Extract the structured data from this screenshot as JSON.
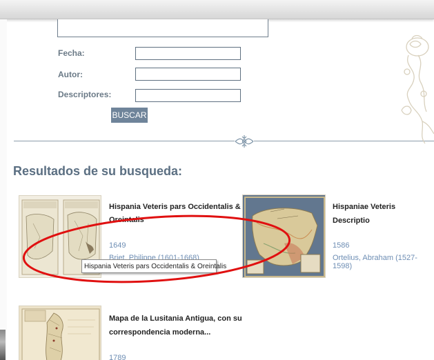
{
  "search_form": {
    "fields": [
      {
        "label": "Fecha:",
        "value": ""
      },
      {
        "label": "Autor:",
        "value": ""
      },
      {
        "label": "Descriptores:",
        "value": ""
      }
    ],
    "search_button_label": "BUSCAR"
  },
  "results": {
    "heading": "Resultados de su busqueda:",
    "items": [
      {
        "title_line1": "Hispania Veteris pars Occidentalis &",
        "title_line2": "Oreintalis",
        "year": "1649",
        "author": "Briet, Philippe (1601-1668)"
      },
      {
        "title_line1": "Hispaniae Veteris Descriptio",
        "title_line2": "",
        "year": "1586",
        "author": "Ortelius, Abraham (1527-1598)"
      },
      {
        "title_line1": "Mapa de la Lusitania Antigua, con su",
        "title_line2": "correspondencia moderna...",
        "year": "1789",
        "author": ""
      }
    ]
  },
  "tooltip": {
    "text": "Hispania Veteris pars Occidentalis & Oreintalis"
  },
  "colors": {
    "accent": "#6f849a",
    "heading": "#5b6f82",
    "link": "#6e8eb4",
    "highlight": "#e01010"
  },
  "icons": {
    "divider": "floral-ornament-icon",
    "corner": "floral-corner-ornament"
  }
}
